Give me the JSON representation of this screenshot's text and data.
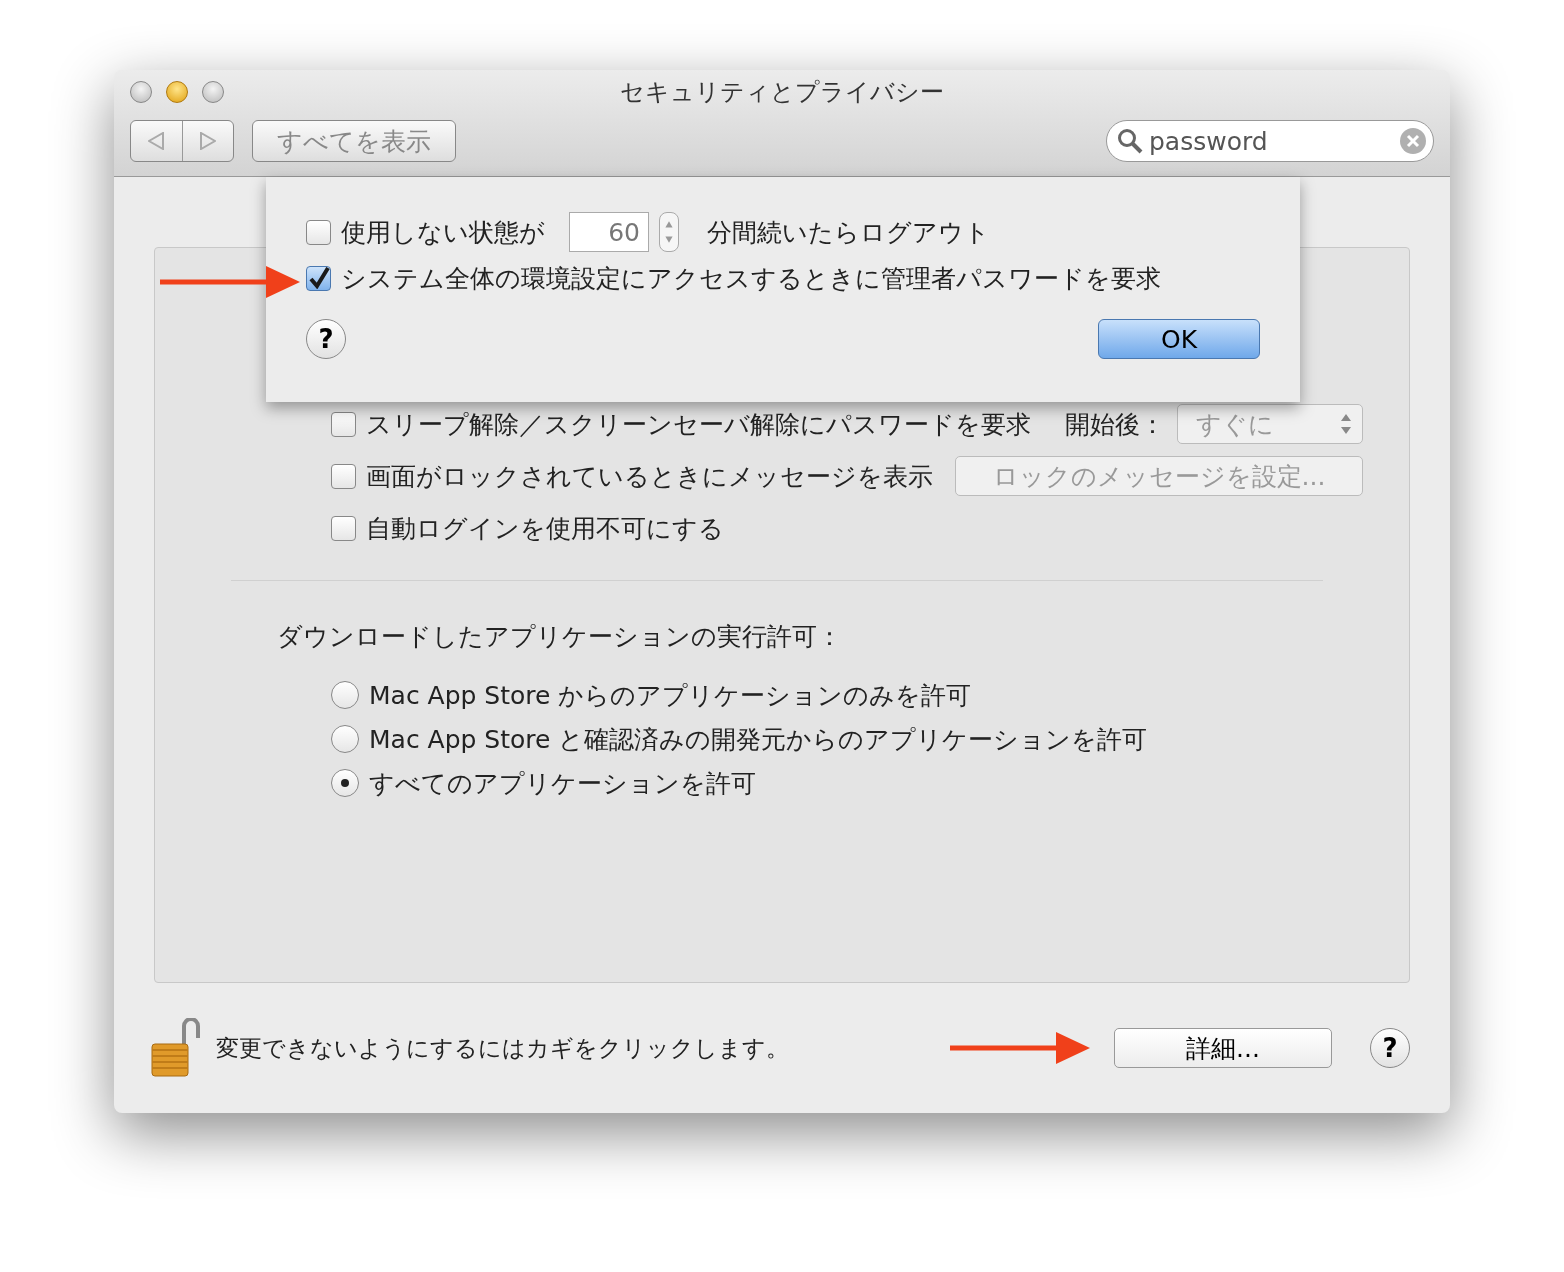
{
  "window": {
    "title": "セキュリティとプライバシー"
  },
  "toolbar": {
    "show_all_button": "すべてを表示",
    "search": {
      "value": "password"
    }
  },
  "sheet": {
    "rows": [
      {
        "kind": "stepper",
        "checked": false,
        "label": "使用しない状態が",
        "value": "60",
        "suffix": "分間続いたらログアウト"
      },
      {
        "kind": "plain",
        "checked": true,
        "label": "システム全体の環境設定にアクセスするときに管理者パスワードを要求"
      }
    ],
    "help_button": "?",
    "ok_button": "OK"
  },
  "options": [
    {
      "kind": "popup",
      "checked": false,
      "label": "スリープ解除／スクリーンセーバ解除にパスワードを要求",
      "after_label": "開始後：",
      "popup": "すぐに"
    },
    {
      "kind": "button",
      "checked": false,
      "label": "画面がロックされているときにメッセージを表示",
      "button": "ロックのメッセージを設定..."
    },
    {
      "kind": "plain",
      "checked": false,
      "label": "自動ログインを使用不可にする"
    }
  ],
  "downloads": {
    "heading": "ダウンロードしたアプリケーションの実行許可：",
    "options": [
      {
        "label": "Mac App Store からのアプリケーションのみを許可",
        "selected": false
      },
      {
        "label": "Mac App Store と確認済みの開発元からのアプリケーションを許可",
        "selected": false
      },
      {
        "label": "すべてのアプリケーションを許可",
        "selected": true
      }
    ]
  },
  "footer": {
    "lock_text": "変更できないようにするにはカギをクリックします。",
    "details_button": "詳細...",
    "help_button": "?"
  }
}
